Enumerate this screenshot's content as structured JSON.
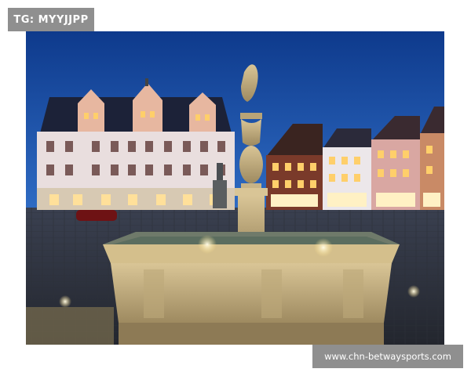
{
  "overlay": {
    "tag_label": "TG: MYYJJPP",
    "watermark_url": "www.chn-betwaysports.com"
  },
  "photo": {
    "subject-icon": "town-square-fountain-at-dusk",
    "colors": {
      "sky_top": "#0e3a8c",
      "sky_bottom": "#2f6cc4",
      "stone": "#c7b387",
      "window_glow": "#ffcf6a"
    }
  }
}
